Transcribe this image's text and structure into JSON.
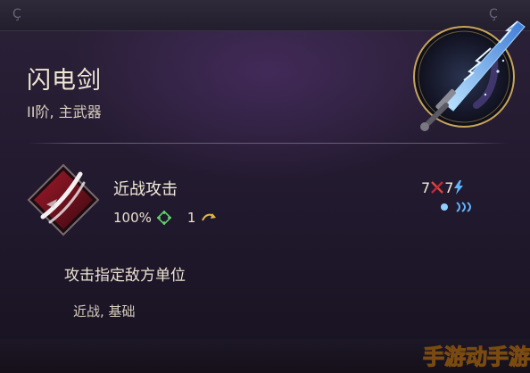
{
  "weapon": {
    "name": "闪电剑",
    "tier_type": "II阶, 主武器"
  },
  "ability": {
    "name": "近战攻击",
    "accuracy": "100%",
    "range": "1",
    "cost_left": "7",
    "cost_right": "7",
    "description": "攻击指定敌方单位",
    "tags": "近战, 基础"
  },
  "header": {
    "corner_glyph_left": "Ç",
    "corner_glyph_right": "Ç"
  },
  "watermark": {
    "text": "手游动手游"
  },
  "colors": {
    "accent_red": "#c3283a",
    "accent_blue": "#5fb6ff",
    "accent_gold": "#e2b844",
    "accent_green": "#5fd46a"
  },
  "icons": {
    "weapon": "lightning-sword-emblem",
    "ability": "slash-attack-icon",
    "accuracy": "crosshair-icon",
    "range": "curved-arrow-icon",
    "damage": "crossed-swords-icon",
    "energy": "lightning-bolt-icon",
    "pips": "movement-pips-icon"
  }
}
